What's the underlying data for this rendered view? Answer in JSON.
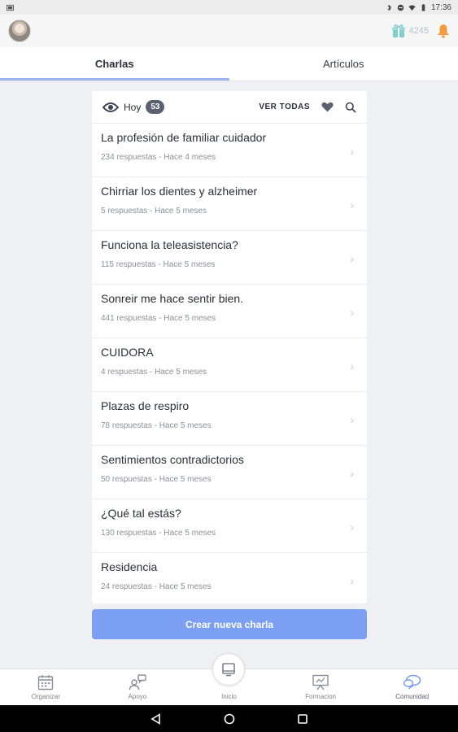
{
  "status_bar": {
    "time": "17:36"
  },
  "header": {
    "points": "4245"
  },
  "tabs": [
    {
      "label": "Charlas",
      "active": true
    },
    {
      "label": "Artículos",
      "active": false
    }
  ],
  "feed": {
    "filter_label": "Hoy",
    "badge_count": "53",
    "see_all": "VER TODAS"
  },
  "threads": [
    {
      "title": "La profesión de familiar cuidador",
      "meta": "234 respuestas - Hace 4 meses"
    },
    {
      "title": "Chirriar los dientes y alzheimer",
      "meta": "5 respuestas - Hace 5 meses"
    },
    {
      "title": "Funciona la teleasistencia?",
      "meta": "115 respuestas - Hace 5 meses"
    },
    {
      "title": "Sonreir me hace sentir bien.",
      "meta": "441 respuestas - Hace 5 meses"
    },
    {
      "title": "CUIDORA",
      "meta": "4 respuestas - Hace 5 meses"
    },
    {
      "title": "Plazas de respiro",
      "meta": "78 respuestas - Hace 5 meses"
    },
    {
      "title": "Sentimientos contradictorios",
      "meta": "50 respuestas - Hace 5 meses"
    },
    {
      "title": "¿Qué tal estás?",
      "meta": "130 respuestas - Hace 5 meses"
    },
    {
      "title": "Residencia",
      "meta": "24 respuestas - Hace 5 meses"
    }
  ],
  "create_button": "Crear nueva charla",
  "bottom_nav": [
    {
      "label": "Organizar",
      "icon": "calendar-icon"
    },
    {
      "label": "Apoyo",
      "icon": "support-icon"
    },
    {
      "label": "Inicio",
      "icon": "home-icon"
    },
    {
      "label": "Formacion",
      "icon": "training-icon"
    },
    {
      "label": "Comunidad",
      "icon": "chat-icon"
    }
  ],
  "colors": {
    "accent": "#7b9ff2",
    "tab_indicator": "#9eb4ef",
    "badge": "#5a6170",
    "bell": "#f39a3a",
    "gift": "#7fcfcf"
  }
}
